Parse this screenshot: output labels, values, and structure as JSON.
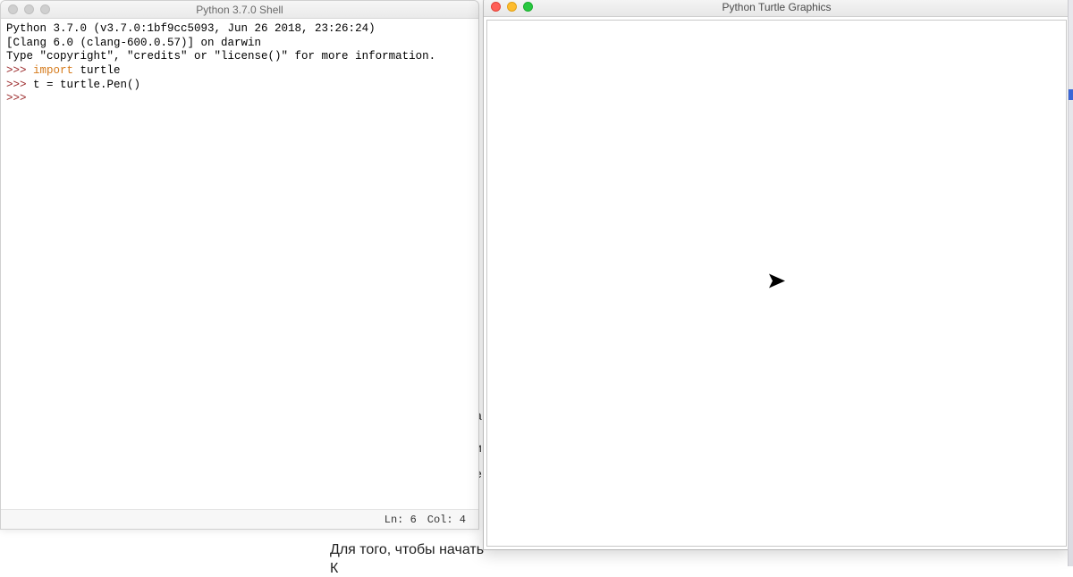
{
  "shell": {
    "title": "Python 3.7.0 Shell",
    "lines": {
      "version": "Python 3.7.0 (v3.7.0:1bf9cc5093, Jun 26 2018, 23:26:24)",
      "compiler": "[Clang 6.0 (clang-600.0.57)] on darwin",
      "hint": "Type \"copyright\", \"credits\" or \"license()\" for more information.",
      "prompt": ">>>",
      "import_kw": "import",
      "import_rest": " turtle",
      "assign": " t = turtle.Pen()"
    },
    "status": {
      "line": "Ln: 6",
      "col": "Col: 4"
    }
  },
  "turtle": {
    "title": "Python Turtle Graphics"
  },
  "background": {
    "line1": "Для того, чтобы начать",
    "line2": "К",
    "frag1": "a",
    "frag2": "и",
    "frag3": "е"
  }
}
